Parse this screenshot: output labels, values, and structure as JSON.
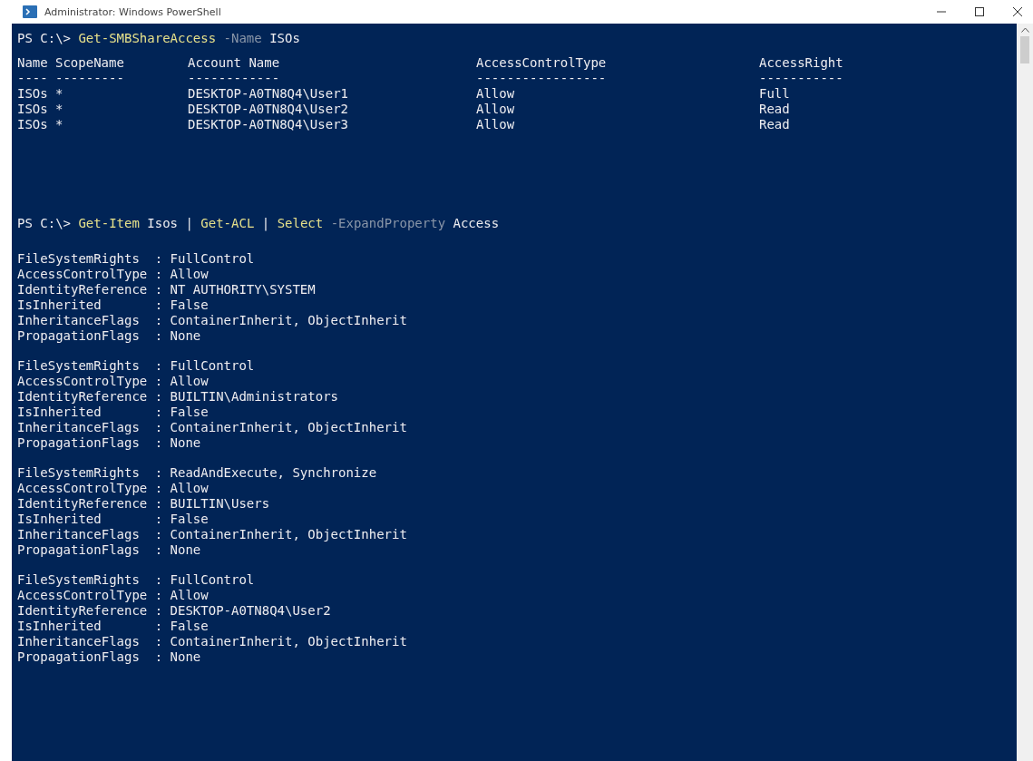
{
  "window": {
    "title": "Administrator: Windows PowerShell"
  },
  "commands": [
    {
      "segments": [
        {
          "kind": "prompt",
          "text": "PS C:\\> "
        },
        {
          "kind": "command",
          "text": "Get-SMBShareAccess"
        },
        {
          "kind": "parameter",
          "text": " -Name"
        },
        {
          "kind": "plain",
          "text": " ISOs"
        }
      ],
      "table": {
        "columns": [
          "Name",
          "ScopeName",
          "Account Name",
          "AccessControlType",
          "AccessRight"
        ],
        "underlines": [
          "----",
          "---------",
          "------------",
          "-----------------",
          "-----------"
        ],
        "rows": [
          [
            "ISOs",
            "*",
            "DESKTOP-A0TN8Q4\\User1",
            "Allow",
            "Full"
          ],
          [
            "ISOs",
            "*",
            "DESKTOP-A0TN8Q4\\User2",
            "Allow",
            "Read"
          ],
          [
            "ISOs",
            "*",
            "DESKTOP-A0TN8Q4\\User3",
            "Allow",
            "Read"
          ]
        ]
      }
    },
    {
      "segments": [
        {
          "kind": "prompt",
          "text": "PS C:\\> "
        },
        {
          "kind": "command",
          "text": "Get-Item"
        },
        {
          "kind": "plain",
          "text": " Isos | "
        },
        {
          "kind": "command",
          "text": "Get-ACL"
        },
        {
          "kind": "plain",
          "text": " | "
        },
        {
          "kind": "command",
          "text": "Select"
        },
        {
          "kind": "parameter",
          "text": " -ExpandProperty"
        },
        {
          "kind": "plain",
          "text": " Access"
        }
      ],
      "entries": [
        [
          "FileSystemRights  : FullControl",
          "AccessControlType : Allow",
          "IdentityReference : NT AUTHORITY\\SYSTEM",
          "IsInherited       : False",
          "InheritanceFlags  : ContainerInherit, ObjectInherit",
          "PropagationFlags  : None"
        ],
        [
          "FileSystemRights  : FullControl",
          "AccessControlType : Allow",
          "IdentityReference : BUILTIN\\Administrators",
          "IsInherited       : False",
          "InheritanceFlags  : ContainerInherit, ObjectInherit",
          "PropagationFlags  : None"
        ],
        [
          "FileSystemRights  : ReadAndExecute, Synchronize",
          "AccessControlType : Allow",
          "IdentityReference : BUILTIN\\Users",
          "IsInherited       : False",
          "InheritanceFlags  : ContainerInherit, ObjectInherit",
          "PropagationFlags  : None"
        ],
        [
          "FileSystemRights  : FullControl",
          "AccessControlType : Allow",
          "IdentityReference : DESKTOP-A0TN8Q4\\User2",
          "IsInherited       : False",
          "InheritanceFlags  : ContainerInherit, ObjectInherit",
          "PropagationFlags  : None"
        ]
      ]
    }
  ]
}
